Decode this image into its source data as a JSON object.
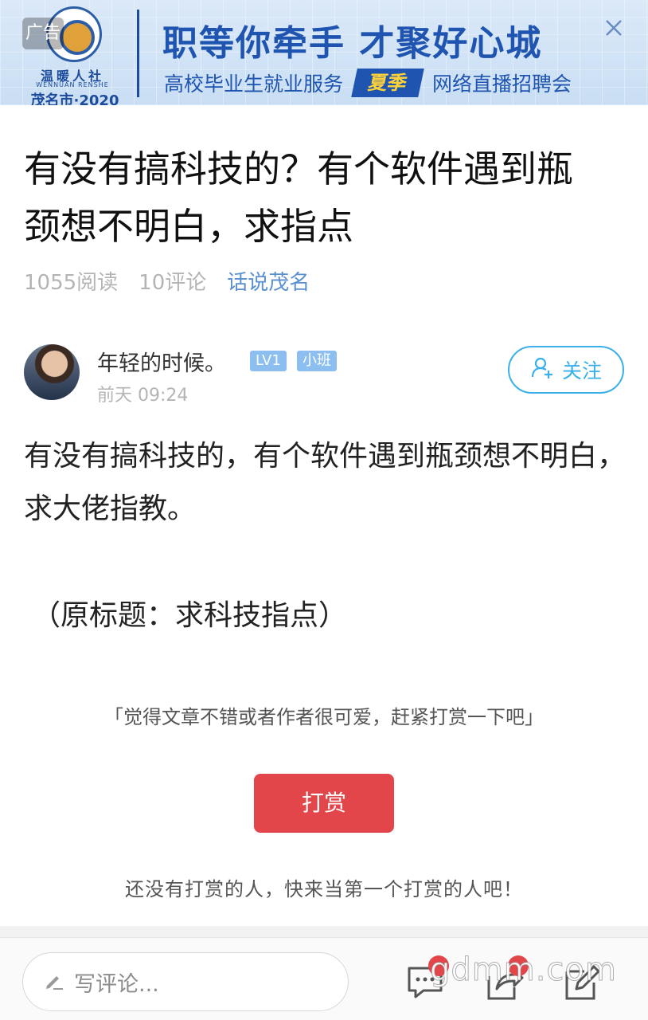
{
  "banner": {
    "ad_label": "广告",
    "org_name": "温暖人社",
    "org_name_en": "WENNUAN RENSHE",
    "org_year": "茂名市·2020",
    "headline": "职等你牵手  才聚好心城",
    "sub_left": "高校毕业生就业服务",
    "season": "夏季",
    "sub_right": "网络直播招聘会",
    "close_icon": "close-icon"
  },
  "post": {
    "title": "有没有搞科技的？有个软件遇到瓶颈想不明白，求指点",
    "reads": "1055阅读",
    "comments": "10评论",
    "topic": "话说茂名"
  },
  "author": {
    "name": "年轻的时候。",
    "level_badge": "LV1",
    "class_badge": "小班",
    "time": "前天 09:24",
    "follow_label": "关注"
  },
  "content": {
    "body": "有没有搞科技的，有个软件遇到瓶颈想不明白，求大佬指教。",
    "original_title": "（原标题：求科技指点）"
  },
  "reward": {
    "prompt": "「觉得文章不错或者作者很可爱，赶紧打赏一下吧」",
    "button_label": "打赏",
    "empty_text": "还没有打赏的人，快来当第一个打赏的人吧！"
  },
  "bottom_bar": {
    "comment_placeholder": "写评论...",
    "icons": [
      "comment-icon",
      "share-icon",
      "edit-icon"
    ]
  },
  "watermark": "gdmm.com",
  "colors": {
    "accent_blue": "#3bb0e8",
    "topic_blue": "#5a8fd0",
    "badge_blue": "#8cbff0",
    "reward_red": "#e2464a",
    "banner_blue": "#1f55b0"
  }
}
